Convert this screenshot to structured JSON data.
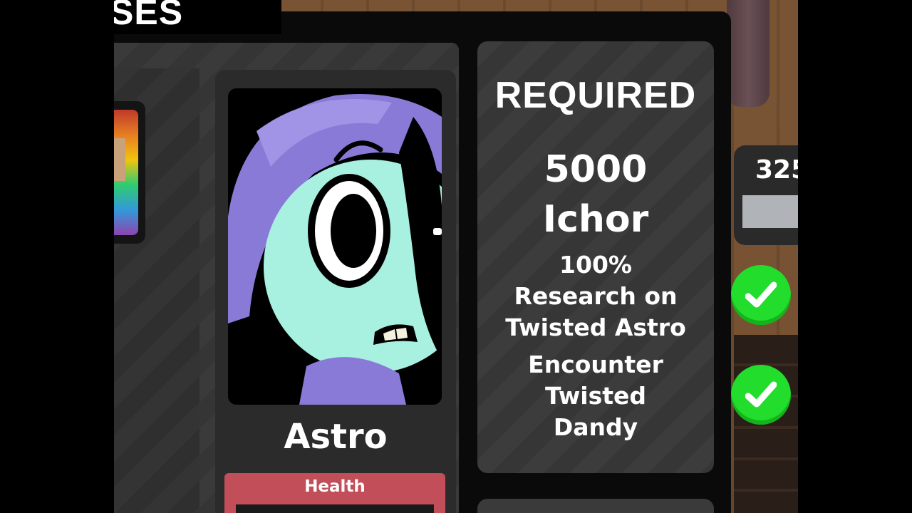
{
  "header": {
    "title": "SES"
  },
  "character": {
    "name": "Astro",
    "health_label": "Health"
  },
  "requirements": {
    "title": "REQUIRED",
    "cost_amount": "5000",
    "cost_currency": "Ichor",
    "research_percent": "100%",
    "research_line1": "Research on",
    "research_line2": "Twisted Astro",
    "encounter_line1": "Encounter",
    "encounter_line2": "Twisted",
    "encounter_line3": "Dandy"
  },
  "side_panel": {
    "value": "325"
  },
  "colors": {
    "check_green": "#22dd2c",
    "health_red": "#c24e5a",
    "astro_face": "#a8f0e0",
    "astro_hood": "#8a7ad8"
  },
  "icons": [
    "checkmark-icon",
    "checkmark-icon"
  ]
}
